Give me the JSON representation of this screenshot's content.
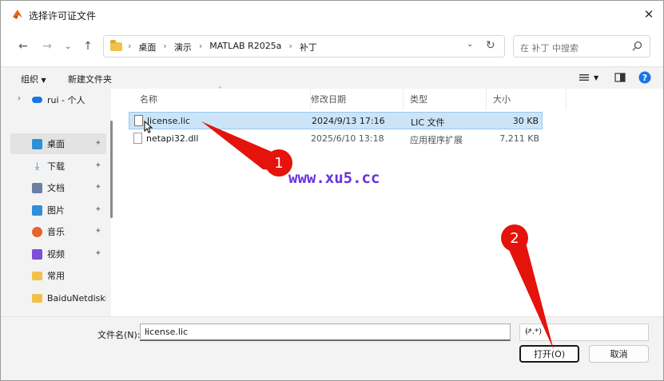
{
  "window": {
    "title": "选择许可证文件"
  },
  "address": {
    "crumbs": [
      "桌面",
      "演示",
      "MATLAB R2025a",
      "补丁"
    ]
  },
  "search": {
    "placeholder": "在 补丁 中搜索"
  },
  "toolbar": {
    "organize": "组织",
    "new_folder": "新建文件夹"
  },
  "sidebar": {
    "items": [
      {
        "label": "rui - 个人",
        "icon": "cloud-icon",
        "color": "#1a73e8"
      },
      {
        "label": "桌面",
        "icon": "desktop-icon",
        "color": "#2f8fd8"
      },
      {
        "label": "下载",
        "icon": "download-icon",
        "color": "#2f8fd8"
      },
      {
        "label": "文档",
        "icon": "document-icon",
        "color": "#6b7fa3"
      },
      {
        "label": "图片",
        "icon": "picture-icon",
        "color": "#2f8fd8"
      },
      {
        "label": "音乐",
        "icon": "music-icon",
        "color": "#e8632a"
      },
      {
        "label": "视频",
        "icon": "video-icon",
        "color": "#7b4fd6"
      },
      {
        "label": "常用",
        "icon": "folder-icon",
        "color": "#f0c14b"
      },
      {
        "label": "BaiduNetdiskD",
        "icon": "folder-icon",
        "color": "#f0c14b"
      }
    ]
  },
  "columns": {
    "name": "名称",
    "date": "修改日期",
    "type": "类型",
    "size": "大小"
  },
  "files": [
    {
      "name": "license.lic",
      "date": "2024/9/13 17:16",
      "type": "LIC 文件",
      "size": "30 KB",
      "selected": true
    },
    {
      "name": "netapi32.dll",
      "date": "2025/6/10 13:18",
      "type": "应用程序扩展",
      "size": "7,211 KB",
      "selected": false
    }
  ],
  "bottom": {
    "filename_label": "文件名(N):",
    "filename_value": "license.lic",
    "filetype_value": "(*.*)",
    "open_label": "打开(O)",
    "cancel_label": "取消"
  },
  "overlay": {
    "watermark": "www.xu5.cc",
    "badge1": "1",
    "badge2": "2",
    "annotation_color": "#e4130c"
  }
}
